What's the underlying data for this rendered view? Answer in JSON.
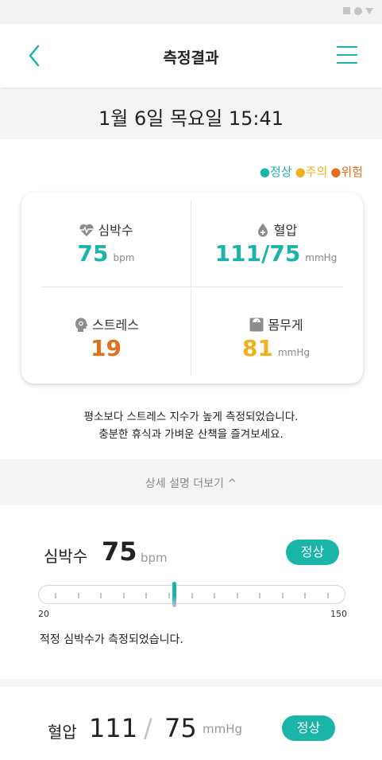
{
  "header": {
    "title": "측정결과"
  },
  "date": "1월 6일 목요일 15:41",
  "legend": {
    "normal": "●정상",
    "caution": "●주의",
    "danger": "●위험"
  },
  "colors": {
    "normal": "#1ab5a8",
    "caution": "#f0b21a",
    "danger": "#e46e1b"
  },
  "metrics": {
    "heart_rate": {
      "label": "심박수",
      "value": "75",
      "unit": "bpm",
      "icon": "heart-pulse-icon"
    },
    "blood_pressure": {
      "label": "혈압",
      "value": "111/75",
      "unit": "mmHg",
      "icon": "blood-drop-plus-icon"
    },
    "stress": {
      "label": "스트레스",
      "value": "19",
      "unit": "",
      "icon": "head-stress-icon"
    },
    "weight": {
      "label": "몸무게",
      "value": "81",
      "unit": "mmHg",
      "icon": "scale-icon"
    }
  },
  "advice": {
    "line1": "평소보다 스트레스 지수가 높게 측정되었습니다.",
    "line2": "충분한 휴식과 가벼운 산책을 즐겨보세요."
  },
  "more": {
    "label": "상세 설명 더보기 ^"
  },
  "heart_detail": {
    "label": "심박수",
    "value": "75",
    "unit": "bpm",
    "status": "정상",
    "gauge_min": "20",
    "gauge_max": "150",
    "gauge_value": 75,
    "message": "적정 심박수가 측정되었습니다."
  },
  "bp_detail": {
    "label": "혈압",
    "systolic": "111",
    "separator": "/",
    "diastolic": "75",
    "unit": "mmHg",
    "status": "정상"
  }
}
